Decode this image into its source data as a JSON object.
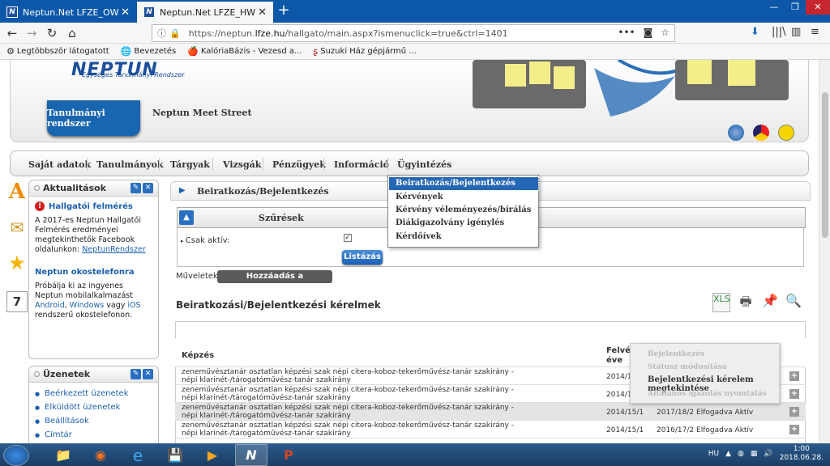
{
  "browser": {
    "tabs": [
      {
        "title": "Neptun.Net LFZE_OW"
      },
      {
        "title": "Neptun.Net LFZE_HW"
      }
    ],
    "new_tab": "+",
    "url_prefix": "https://neptun.",
    "url_domain": "lfze.hu",
    "url_path": "/hallgato/main.aspx?ismenuclick=true&ctrl=1401",
    "bookmarks": [
      "Legtöbbször látogatott",
      "Bevezetés",
      "KalóriaBázis - Vezesd a...",
      "Suzuki Ház gépjármű ..."
    ]
  },
  "header": {
    "logo": "NEPTUN",
    "logo_sub": "Egységes Tanulmányi Rendszer",
    "active_tab": "Tanulmányi rendszer",
    "second_tab": "Neptun Meet Street"
  },
  "menu": {
    "items": [
      "Saját adatok",
      "Tanulmányok",
      "Tárgyak",
      "Vizsgák",
      "Pénzügyek",
      "Információ",
      "Ügyintézés"
    ]
  },
  "dropdown": {
    "items": [
      "Beiratkozás/Bejelentkezés",
      "Kérvények",
      "Kérvény véleményezés/bírálás",
      "Diákigazolvány igénylés",
      "Kérdőívek"
    ]
  },
  "news_panel": {
    "title": "Aktualitások",
    "item1_title": "Hallgatói felmérés",
    "item1_text": "A 2017-es Neptun Hallgatói Felmérés eredményei megtekinthetők Facebook oldalunkon:",
    "item1_link": "NeptunRendszer",
    "item2_title": "Neptun okostelefonra",
    "item2_text_a": "Próbálja ki az ingyenes Neptun mobilalkalmazást",
    "item2_android": "Android",
    "item2_comma": ",",
    "item2_windows": "Windows",
    "item2_or": "vagy",
    "item2_ios": "iOS",
    "item2_text_b": "rendszerű okostelefonon."
  },
  "messages_panel": {
    "title": "Üzenetek",
    "items": [
      "Beérkezett üzenetek",
      "Elküldött üzenetek",
      "Beállítások",
      "Címtár"
    ]
  },
  "main": {
    "title": "Beiratkozás/Bejelentkezés",
    "filters_title": "Szűrések",
    "only_active_label": "Csak aktív:",
    "only_active_checked": true,
    "list_button": "Listázás",
    "actions_label": "Műveletek:",
    "add_fav_button": "Hozzáadás a kedvencekhez",
    "section_title": "Beiratkozási/Bejelentkezési kérelmek",
    "col_kepzes": "Képzés",
    "col_felvetel": "Felvé- éve",
    "rows": [
      {
        "kepzes": "zeneművésztanár osztatlan képzési szak népi citera-koboz-tekerőművész-tanár szakirány - népi klarinét-/tárogatóművész-tanár szakirány",
        "year": "2014/1",
        "period": "",
        "status": ""
      },
      {
        "kepzes": "zeneművésztanár osztatlan képzési szak népi citera-koboz-tekerőművész-tanár szakirány - népi klarinét-/tárogatóművész-tanár szakirány",
        "year": "2014/1",
        "period": "",
        "status": ""
      },
      {
        "kepzes": "zeneművésztanár osztatlan képzési szak népi citera-koboz-tekerőművész-tanár szakirány - népi klarinét-/tárogatóművész-tanár szakirány",
        "year": "2014/15/1",
        "period": "2017/18/2",
        "status": "Elfogadva Aktív"
      },
      {
        "kepzes": "zeneművésztanár osztatlan képzési szak népi citera-koboz-tekerőművész-tanár szakirány - népi klarinét-/tárogatóművész-tanár szakirány",
        "year": "2014/15/1",
        "period": "2016/17/2",
        "status": "Elfogadva Aktív"
      }
    ]
  },
  "context_menu": {
    "items": [
      "Bejelentkezés",
      "Státusz módosítása",
      "Bejelentkezési kérelem megtekintése",
      "Általános igazolás nyomtatás"
    ]
  },
  "taskbar": {
    "lang": "HU",
    "time": "1:00",
    "date": "2018.06.28."
  },
  "colors": {
    "accent": "#1966b0",
    "selection": "#2467b5",
    "tabbar": "#0d57a8"
  }
}
